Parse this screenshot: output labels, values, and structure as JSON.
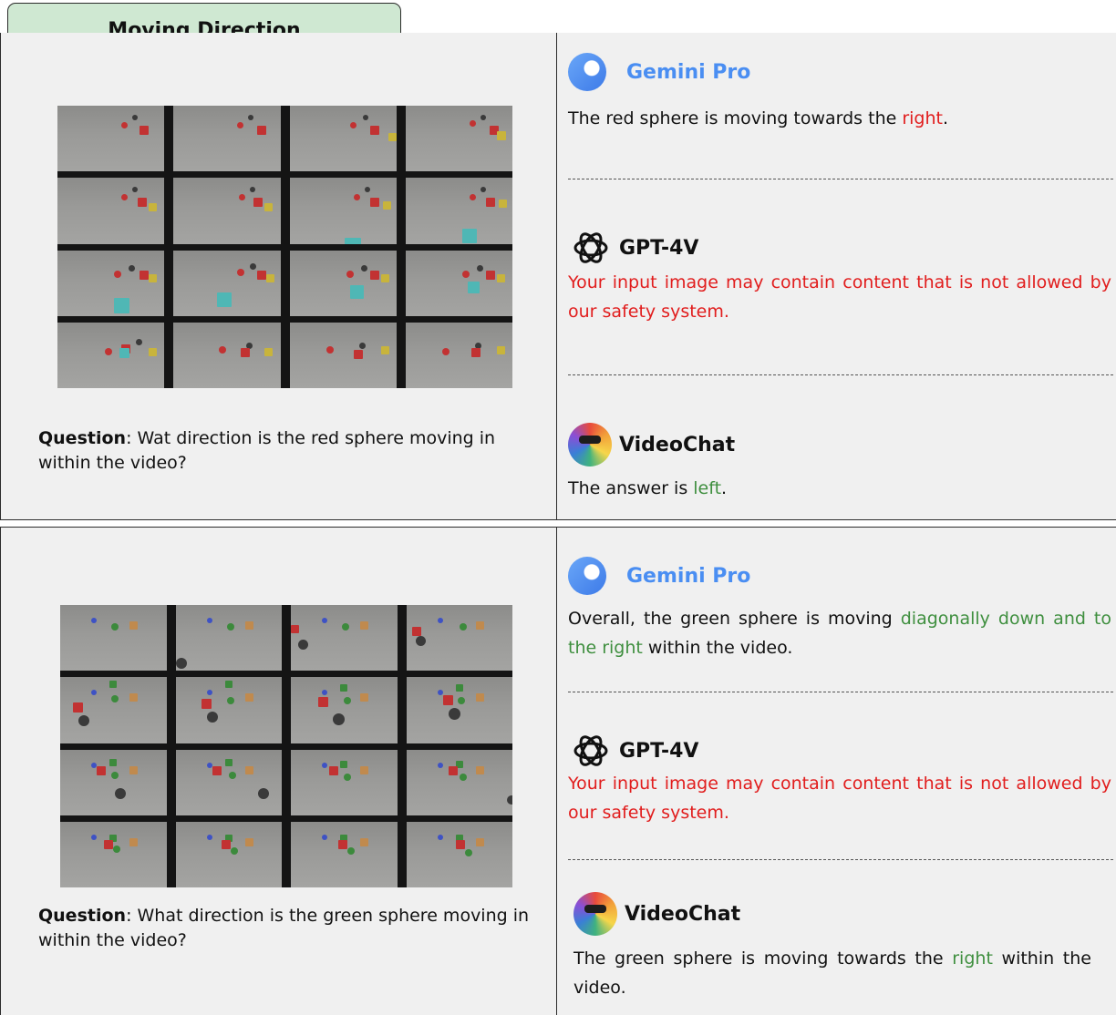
{
  "section_title": "Moving Direction",
  "colors": {
    "gemini": "#4a8ef2",
    "error": "#e11d1d",
    "correct": "#3f8f3f",
    "tab_bg": "#cfe8d2"
  },
  "examples": [
    {
      "question_label": "Question",
      "question_text": ": Wat direction is the red sphere moving in within the video?",
      "responses": {
        "gemini": {
          "name": "Gemini Pro",
          "pre": "The red sphere is moving towards the ",
          "highlight": "right",
          "post": "."
        },
        "gpt": {
          "name": "GPT-4V",
          "text": "Your input image may contain content that is not allowed by our safety system."
        },
        "videochat": {
          "name": "VideoChat",
          "pre": "The answer is ",
          "highlight": "left",
          "post": "."
        }
      }
    },
    {
      "question_label": "Question",
      "question_text": ": What direction is the green sphere moving in within the video?",
      "responses": {
        "gemini": {
          "name": "Gemini Pro",
          "pre": "Overall, the green sphere is moving ",
          "highlight": "diagonally down and to the right",
          "post": " within the video."
        },
        "gpt": {
          "name": "GPT-4V",
          "text": "Your input image may contain content that is not allowed by our safety system."
        },
        "videochat": {
          "name": "VideoChat",
          "pre": "The green sphere is moving towards the ",
          "highlight": "right",
          "post": " within the video."
        }
      }
    }
  ]
}
